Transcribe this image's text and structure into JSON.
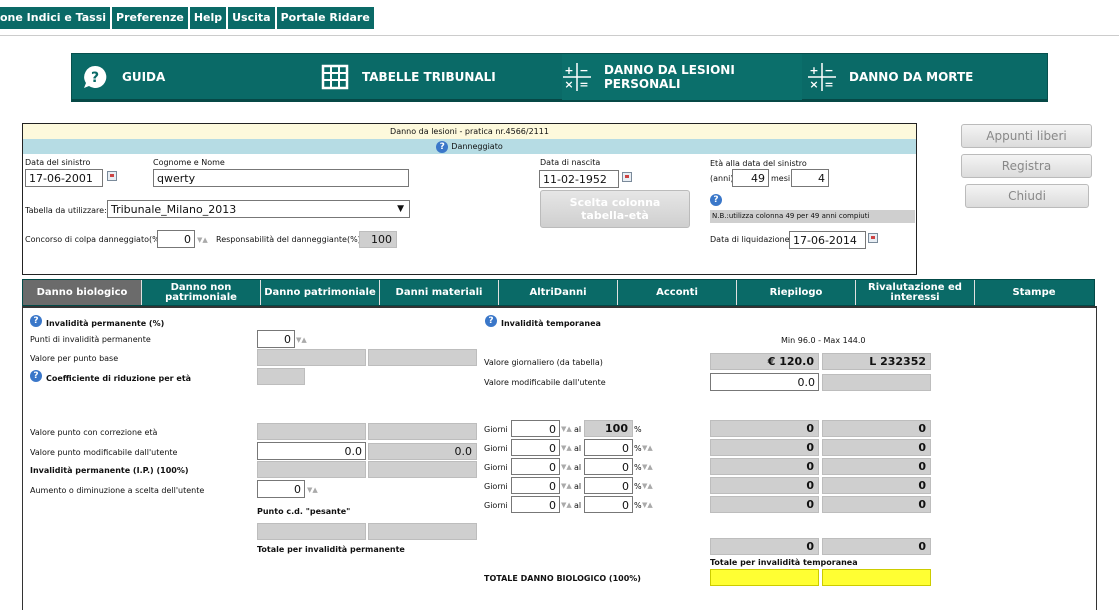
{
  "menu": [
    "one Indici e Tassi",
    "Preferenze",
    "Help",
    "Uscita",
    "Portale Ridare"
  ],
  "nav": {
    "guida": "GUIDA",
    "tabelle": "TABELLE TRIBUNALI",
    "lesioni": "DANNO DA LESIONI PERSONALI",
    "morte": "DANNO DA MORTE"
  },
  "header": {
    "title": "Danno da lesioni - pratica nr.4566/2111",
    "subtitle": "Danneggiato"
  },
  "form": {
    "data_sinistro_label": "Data del sinistro",
    "data_sinistro": "17-06-2001",
    "cognome_label": "Cognome e Nome",
    "cognome": "qwerty",
    "nascita_label": "Data di nascita",
    "nascita": "11-02-1952",
    "eta_label": "Età alla data del sinistro",
    "anni_label": "(anni)",
    "anni": "49",
    "mesi_label": "mesi",
    "mesi": "4",
    "tabella_label": "Tabella da utilizzare:",
    "tabella": "Tribunale_Milano_2013",
    "scelta_btn": "Scelta colonna tabella-età",
    "nb": "N.B.:utilizza colonna 49 per 49 anni compiuti",
    "concorso_label": "Concorso di colpa danneggiato(%):",
    "concorso": "0",
    "resp_label": "Responsabilità del danneggiante(%):",
    "resp": "100",
    "liquid_label": "Data di liquidazione:",
    "liquid": "17-06-2014"
  },
  "side": {
    "appunti": "Appunti liberi",
    "registra": "Registra",
    "chiudi": "Chiudi"
  },
  "tabs": [
    "Danno biologico",
    "Danno non patrimoniale",
    "Danno patrimoniale",
    "Danni materiali",
    "AltriDanni",
    "Acconti",
    "Riepilogo",
    "Rivalutazione ed interessi",
    "Stampe"
  ],
  "perm": {
    "title": "Invalidità permanente (%)",
    "punti_label": "Punti di invalidità permanente",
    "punti": "0",
    "valore_base": "Valore per punto base",
    "coeff": "Coefficiente di riduzione per età",
    "corr": "Valore punto con correzione età",
    "modif": "Valore punto modificabile dall'utente",
    "modif_v1": "0.0",
    "modif_v2": "0.0",
    "ip": "Invalidità permanente (I.P.) (100%)",
    "aumento": "Aumento o diminuzione a scelta dell'utente",
    "aumento_v": "0",
    "pesante": "Punto c.d. \"pesante\"",
    "totale": "Totale per invalidità permanente"
  },
  "temp": {
    "title": "Invalidità temporanea",
    "minmax": "Min 96.0 - Max 144.0",
    "giorn_label": "Valore giornaliero (da tabella)",
    "euro": "€ 120.0",
    "lire": "L 232352",
    "modif_label": "Valore modificabile dall'utente",
    "modif": "0.0",
    "giorni_label": "Giorni",
    "al": "al",
    "pct": "%",
    "rows": [
      {
        "g": "0",
        "p": "100"
      },
      {
        "g": "0",
        "p": "0"
      },
      {
        "g": "0",
        "p": "0"
      },
      {
        "g": "0",
        "p": "0"
      },
      {
        "g": "0",
        "p": "0"
      }
    ],
    "res": [
      "0",
      "0"
    ],
    "tot": [
      "0",
      "0"
    ],
    "totale": "Totale per invalidità temporanea",
    "totale_bio": "TOTALE DANNO BIOLOGICO (100%)"
  },
  "colors": {
    "teal": "#0a6a67",
    "yellow": "#ffff33"
  }
}
